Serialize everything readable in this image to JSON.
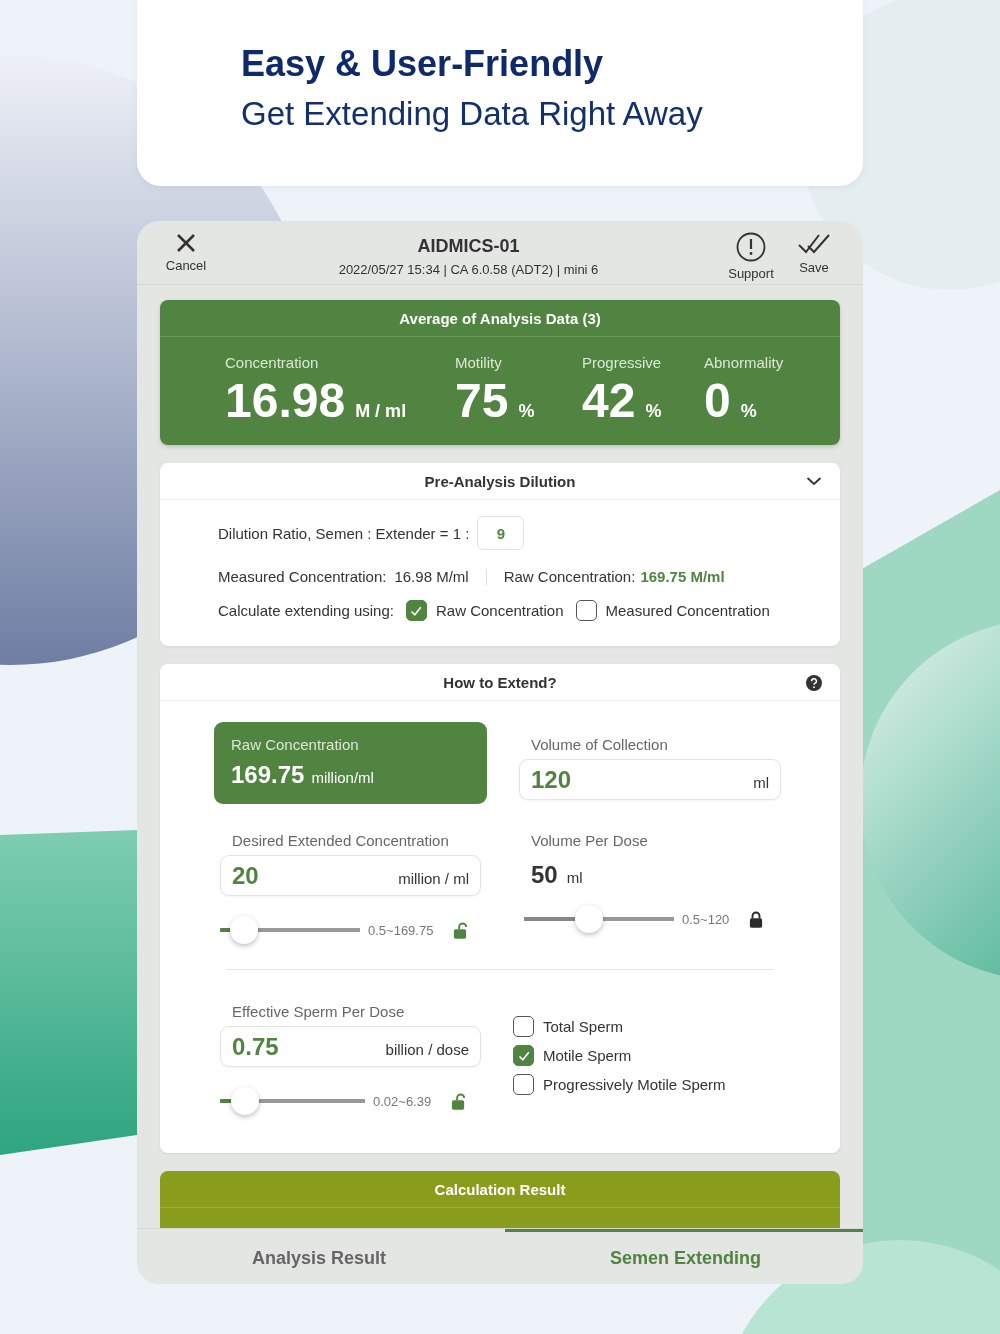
{
  "headline": {
    "title": "Easy & User-Friendly",
    "subtitle": "Get Extending Data Right Away"
  },
  "header": {
    "cancel": "Cancel",
    "title": "AIDMICS-01",
    "subtitle": "2022/05/27 15:34 | CA 6.0.58 (ADT2) | mini 6",
    "support": "Support",
    "save": "Save"
  },
  "average": {
    "title": "Average of Analysis Data (3)",
    "metrics": [
      {
        "label": "Concentration",
        "value": "16.98",
        "unit": "M / ml"
      },
      {
        "label": "Motility",
        "value": "75",
        "unit": "%"
      },
      {
        "label": "Progressive",
        "value": "42",
        "unit": "%"
      },
      {
        "label": "Abnormality",
        "value": "0",
        "unit": "%"
      }
    ]
  },
  "dilution": {
    "title": "Pre-Analysis Dilution",
    "ratio_label": "Dilution Ratio, Semen : Extender = 1 :",
    "ratio_value": "9",
    "measured_label": "Measured Concentration:",
    "measured_value": "16.98 M/ml",
    "raw_label": "Raw Concentration:",
    "raw_value": "169.75 M/ml",
    "using_label": "Calculate extending using:",
    "options": [
      {
        "label": "Raw Concentration",
        "checked": true
      },
      {
        "label": "Measured Concentration",
        "checked": false
      }
    ]
  },
  "extend": {
    "title": "How to Extend?",
    "raw": {
      "label": "Raw Concentration",
      "value": "169.75",
      "unit": "million/ml"
    },
    "collection": {
      "label": "Volume of Collection",
      "value": "120",
      "unit": "ml"
    },
    "desired": {
      "label": "Desired Extended Concentration",
      "value": "20",
      "unit": "million / ml",
      "range": "0.5~169.75",
      "level": 0.17,
      "locked": false
    },
    "per_dose": {
      "label": "Volume Per Dose",
      "value": "50",
      "unit": "ml",
      "range": "0.5~120",
      "level": 0.43,
      "locked": true
    },
    "effective": {
      "label": "Effective Sperm Per Dose",
      "value": "0.75",
      "unit": "billion / dose",
      "range": "0.02~6.39",
      "level": 0.17,
      "locked": false
    },
    "sperm_types": [
      {
        "label": "Total Sperm",
        "checked": false
      },
      {
        "label": "Motile Sperm",
        "checked": true
      },
      {
        "label": "Progressively Motile Sperm",
        "checked": false
      }
    ]
  },
  "result": {
    "title": "Calculation Result"
  },
  "tabs": [
    {
      "label": "Analysis Result",
      "selected": false
    },
    {
      "label": "Semen Extending",
      "selected": true
    }
  ]
}
